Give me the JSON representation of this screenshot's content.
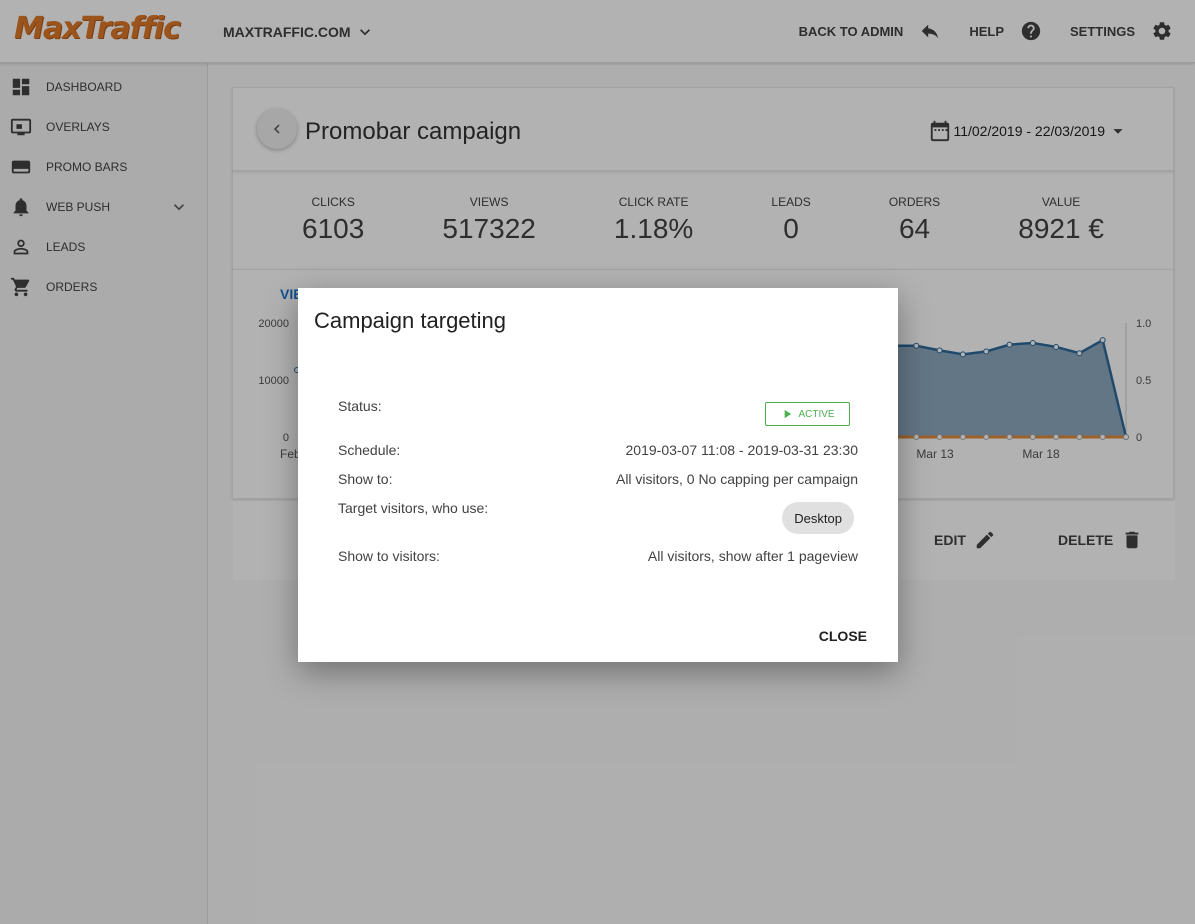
{
  "header": {
    "logo": "MaxTraffic",
    "site": "MAXTRAFFIC.COM",
    "back_to_admin": "BACK TO ADMIN",
    "help": "HELP",
    "settings": "SETTINGS"
  },
  "sidebar": {
    "items": [
      {
        "label": "DASHBOARD",
        "icon": "dashboard-icon"
      },
      {
        "label": "OVERLAYS",
        "icon": "monitor-icon"
      },
      {
        "label": "PROMO BARS",
        "icon": "promobar-icon"
      },
      {
        "label": "WEB PUSH",
        "icon": "bell-icon"
      },
      {
        "label": "LEADS",
        "icon": "person-icon"
      },
      {
        "label": "ORDERS",
        "icon": "cart-icon"
      }
    ]
  },
  "campaign": {
    "title": "Promobar campaign",
    "date_range": "11/02/2019 - 22/03/2019"
  },
  "stats": [
    {
      "label": "CLICKS",
      "value": "6103"
    },
    {
      "label": "VIEWS",
      "value": "517322"
    },
    {
      "label": "CLICK RATE",
      "value": "1.18%"
    },
    {
      "label": "LEADS",
      "value": "0"
    },
    {
      "label": "ORDERS",
      "value": "64"
    },
    {
      "label": "VALUE",
      "value": "8921 €"
    }
  ],
  "chart": {
    "tab_label": "VIE",
    "left_ticks": [
      "20000",
      "10000",
      "0"
    ],
    "right_ticks": [
      "1.0",
      "0.5",
      "0"
    ],
    "x_labels": [
      "Feb",
      "Mar 13",
      "Mar 18"
    ]
  },
  "chart_data": {
    "type": "area",
    "series": [
      {
        "values": [
          16000,
          16000,
          15200,
          14500,
          15000,
          16200,
          16500,
          15800,
          14700,
          17000,
          0
        ]
      },
      {
        "values": [
          0,
          0,
          0,
          0,
          0,
          0,
          0,
          0,
          0,
          0,
          0
        ]
      }
    ],
    "ylim_left": [
      0,
      20000
    ],
    "ylim_right": [
      0,
      1.0
    ]
  },
  "actions": {
    "edit": "EDIT",
    "delete": "DELETE"
  },
  "dialog": {
    "title": "Campaign targeting",
    "status_label": "Status:",
    "status_value": "ACTIVE",
    "schedule_label": "Schedule:",
    "schedule_value": "2019-03-07 11:08 - 2019-03-31 23:30",
    "show_to_label": "Show to:",
    "show_to_value": "All visitors, 0  No capping  per campaign",
    "target_label": "Target visitors, who use:",
    "target_chip": "Desktop",
    "show_visitors_label": "Show to visitors:",
    "show_visitors_value": "All visitors, show after 1  pageview",
    "close": "CLOSE"
  },
  "colors": {
    "accent": "#e0792a",
    "area": "#7b9bb5",
    "line": "#2e6a9a",
    "orange_line": "#e08a3c",
    "active": "#4caf50"
  }
}
